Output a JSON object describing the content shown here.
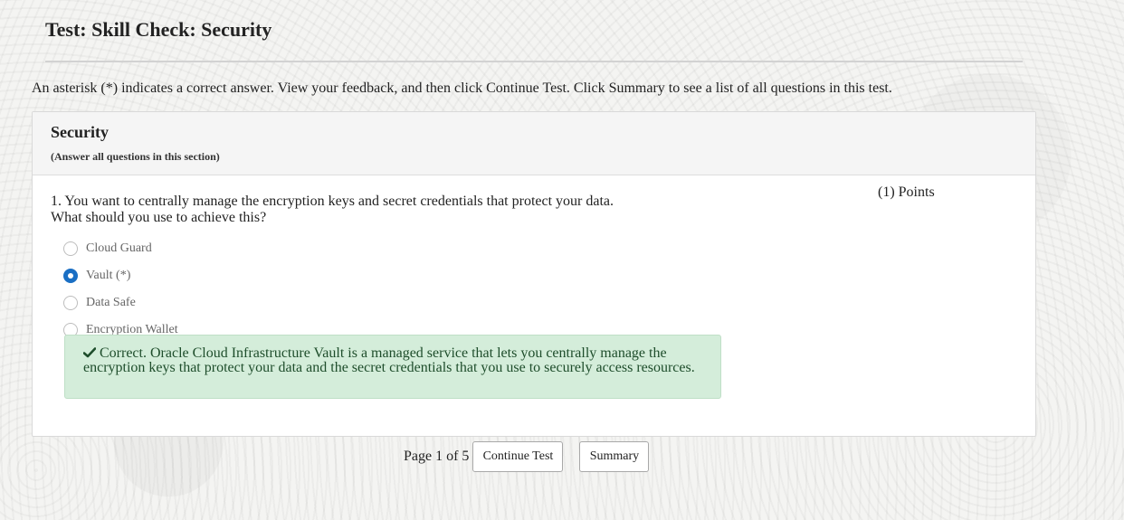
{
  "page": {
    "title": "Test: Skill Check: Security",
    "instructions": "An asterisk (*) indicates a correct answer. View your feedback, and then click Continue Test. Click Summary to see a list of all questions in this test."
  },
  "section": {
    "title": "Security",
    "note": "(Answer all questions in this section)"
  },
  "question": {
    "line1": "1. You want to centrally manage the encryption keys and secret credentials that protect your data.",
    "line2": "What should you use to achieve this?",
    "points": "(1) Points",
    "options": [
      {
        "label": "Cloud Guard",
        "selected": false
      },
      {
        "label": "Vault (*)",
        "selected": true
      },
      {
        "label": "Data Safe",
        "selected": false
      },
      {
        "label": "Encryption Wallet",
        "selected": false
      }
    ],
    "feedback": "Correct. Oracle Cloud Infrastructure Vault is a managed service that lets you centrally manage the encryption keys that protect your data and the secret credentials that you use to securely access resources."
  },
  "footer": {
    "page_indicator": "Page 1 of 5",
    "continue_label": "Continue Test",
    "summary_label": "Summary"
  },
  "colors": {
    "selected_radio": "#1a6fc4",
    "feedback_bg": "#d4edda",
    "feedback_text": "#1e4d2b"
  },
  "icons": {
    "feedback": "check-icon"
  }
}
